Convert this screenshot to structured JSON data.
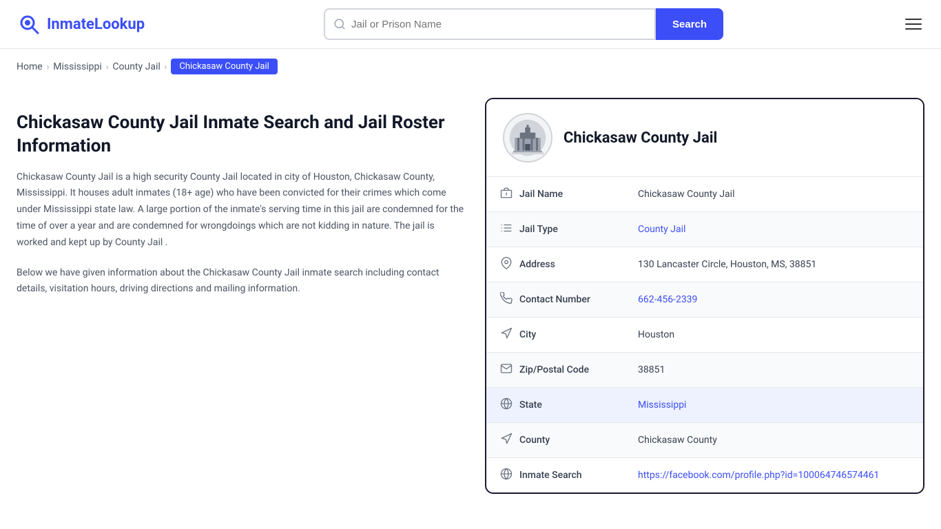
{
  "header": {
    "logo_text_bold": "Inmate",
    "logo_text_light": "Lookup",
    "search_placeholder": "Jail or Prison Name",
    "search_button_label": "Search",
    "menu_label": "Menu"
  },
  "breadcrumb": {
    "home": "Home",
    "state": "Mississippi",
    "type": "County Jail",
    "active": "Chickasaw County Jail"
  },
  "page": {
    "title": "Chickasaw County Jail Inmate Search and Jail Roster Information",
    "description1": "Chickasaw County Jail is a high security County Jail located in city of Houston, Chickasaw County, Mississippi. It houses adult inmates (18+ age) who have been convicted for their crimes which come under Mississippi state law. A large portion of the inmate's serving time in this jail are condemned for the time of over a year and are condemned for wrongdoings which are not kidding in nature. The jail is worked and kept up by County Jail .",
    "description2": "Below we have given information about the Chickasaw County Jail inmate search including contact details, visitation hours, driving directions and mailing information."
  },
  "card": {
    "jail_name": "Chickasaw County Jail",
    "fields": [
      {
        "icon": "jail-icon",
        "label": "Jail Name",
        "value": "Chickasaw County Jail",
        "type": "text"
      },
      {
        "icon": "type-icon",
        "label": "Jail Type",
        "value": "County Jail",
        "type": "link",
        "href": "#"
      },
      {
        "icon": "address-icon",
        "label": "Address",
        "value": "130 Lancaster Circle, Houston, MS, 38851",
        "type": "text"
      },
      {
        "icon": "phone-icon",
        "label": "Contact Number",
        "value": "662-456-2339",
        "type": "link",
        "href": "tel:662-456-2339"
      },
      {
        "icon": "city-icon",
        "label": "City",
        "value": "Houston",
        "type": "text"
      },
      {
        "icon": "zip-icon",
        "label": "Zip/Postal Code",
        "value": "38851",
        "type": "text"
      },
      {
        "icon": "state-icon",
        "label": "State",
        "value": "Mississippi",
        "type": "link",
        "href": "#",
        "highlighted": true
      },
      {
        "icon": "county-icon",
        "label": "County",
        "value": "Chickasaw County",
        "type": "text"
      },
      {
        "icon": "inmate-icon",
        "label": "Inmate Search",
        "value": "https://facebook.com/profile.php?id=100064746574461",
        "type": "link",
        "href": "https://facebook.com/profile.php?id=100064746574461"
      }
    ]
  },
  "icons": {
    "jail-icon": "🏛",
    "type-icon": "≡",
    "address-icon": "📍",
    "phone-icon": "📞",
    "city-icon": "🗺",
    "zip-icon": "✉",
    "state-icon": "🌐",
    "county-icon": "🗺",
    "inmate-icon": "🌐"
  }
}
